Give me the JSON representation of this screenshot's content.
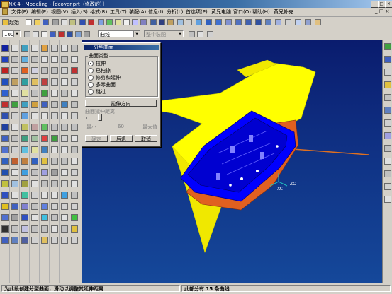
{
  "window": {
    "title": "NX 4 - Modeling - [dcover.prt（修改的）]",
    "buttons": [
      "_",
      "□",
      "×"
    ]
  },
  "menubar": {
    "items": [
      "文件(F)",
      "编辑(E)",
      "视图(V)",
      "插入(S)",
      "格式(R)",
      "工具(T)",
      "装配(A)",
      "信息(I)",
      "分析(L)",
      "首选项(P)",
      "黄兄电脑",
      "窗口(O)",
      "帮助(H)",
      "黄兄补充"
    ]
  },
  "toolbar": {
    "start_label": "起始",
    "zoom_value": "100",
    "filter_value": "曲线",
    "assembly_value": "整个装配"
  },
  "dialog": {
    "title": "分型曲面",
    "group_label": "曲面类型",
    "options": [
      "拉伸",
      "已扫掠",
      "修剪和延伸",
      "多零曲面",
      "跳过"
    ],
    "selected_index": 0,
    "direction_button": "拉伸方向",
    "slider_label": "曲面延伸距离",
    "slider_min": "最小",
    "slider_value": "60",
    "slider_max": "最大值",
    "ok_label": "确定",
    "back_label": "后退",
    "cancel_label": "取消"
  },
  "axes": {
    "xc": "XC",
    "zc": "ZC"
  },
  "status": {
    "prompt": "为此段创建分型曲面，滑动以调整其延伸距离",
    "info": "此部分有 15 条曲线"
  },
  "colors": {
    "surface": "#ffff00",
    "part": "#0000ff",
    "mold_base": "#e06020",
    "background_top": "#0a1c6e",
    "background_bottom": "#15489a",
    "title_active": "#0a246a"
  }
}
